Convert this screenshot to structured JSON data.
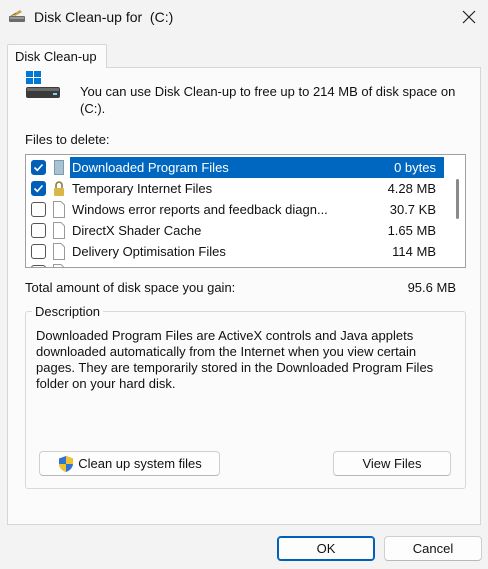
{
  "window": {
    "title": "Disk Clean-up for  (C:)",
    "title_icon": "disk-cleanup-icon",
    "close_icon": "close-icon"
  },
  "tab": {
    "label": "Disk Clean-up"
  },
  "intro": {
    "icon": "drive-icon",
    "text": "You can use Disk Clean-up to free up to 214 MB of disk space on (C:)."
  },
  "files": {
    "label": "Files to delete:",
    "items": [
      {
        "name": "Downloaded Program Files",
        "size": "0 bytes",
        "checked": true,
        "selected": true,
        "icon": "folder-icon"
      },
      {
        "name": "Temporary Internet Files",
        "size": "4.28 MB",
        "checked": true,
        "selected": false,
        "icon": "lock-icon"
      },
      {
        "name": "Windows error reports and feedback diagn...",
        "size": "30.7 KB",
        "checked": false,
        "selected": false,
        "icon": "file-icon"
      },
      {
        "name": "DirectX Shader Cache",
        "size": "1.65 MB",
        "checked": false,
        "selected": false,
        "icon": "file-icon"
      },
      {
        "name": "Delivery Optimisation Files",
        "size": "114 MB",
        "checked": false,
        "selected": false,
        "icon": "file-icon"
      }
    ]
  },
  "total": {
    "label": "Total amount of disk space you gain:",
    "value": "95.6 MB"
  },
  "description": {
    "legend": "Description",
    "text": "Downloaded Program Files are ActiveX controls and Java applets downloaded automatically from the Internet when you view certain pages. They are temporarily stored in the Downloaded Program Files folder on your hard disk."
  },
  "buttons": {
    "cleanup_label": "Clean up system files",
    "cleanup_icon": "uac-shield-icon",
    "view_label": "View Files",
    "ok_label": "OK",
    "cancel_label": "Cancel"
  },
  "colors": {
    "accent": "#0067c0",
    "window_bg": "#f3f3f3",
    "panel_bg": "#fbfbfb"
  }
}
